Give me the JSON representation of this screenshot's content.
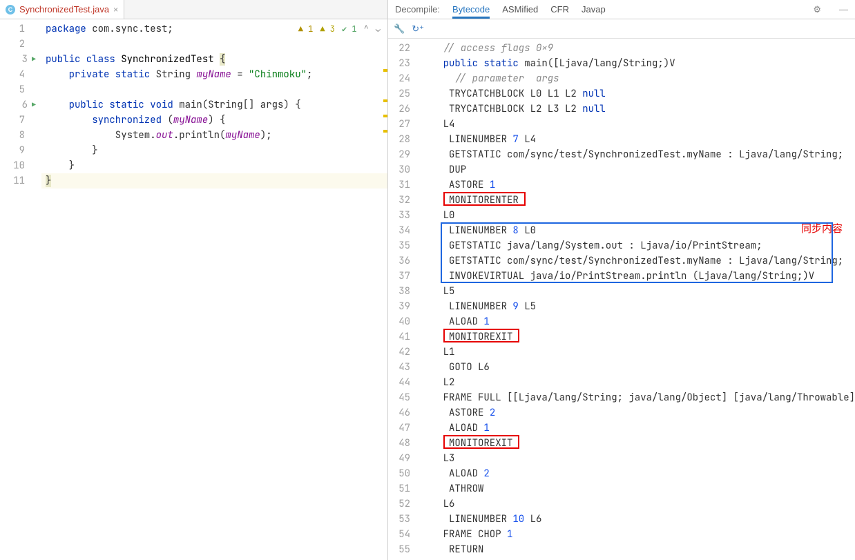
{
  "leftTab": {
    "fileName": "SynchronizedTest.java",
    "fileIconLetter": "C"
  },
  "inspection": {
    "warn1": "1",
    "warn2": "3",
    "ok": "1"
  },
  "sourceLines": [
    {
      "n": "1",
      "run": false,
      "html": "<span class='kw'>package</span> com.sync.test;"
    },
    {
      "n": "2",
      "run": false,
      "html": ""
    },
    {
      "n": "3",
      "run": true,
      "html": "<span class='kw'>public class</span> <span class='cls'>SynchronizedTest</span> <span class='brace'>{</span>"
    },
    {
      "n": "4",
      "run": false,
      "html": "    <span class='kw'>private static</span> String <span class='fld'>myName</span> = <span class='str'>\"Chinmoku\"</span>;"
    },
    {
      "n": "5",
      "run": false,
      "html": ""
    },
    {
      "n": "6",
      "run": true,
      "html": "    <span class='kw'>public static void</span> main(String[] args) {"
    },
    {
      "n": "7",
      "run": false,
      "html": "        <span class='kw'>synchronized</span> (<span class='fld'>myName</span>) {"
    },
    {
      "n": "8",
      "run": false,
      "html": "            System.<span class='fld stat'>out</span>.println(<span class='fld'>myName</span>);"
    },
    {
      "n": "9",
      "run": false,
      "html": "        }"
    },
    {
      "n": "10",
      "run": false,
      "html": "    }"
    },
    {
      "n": "11",
      "run": false,
      "hl": true,
      "html": "<span class='brace'>}</span>"
    }
  ],
  "rightHeader": {
    "label": "Decompile:",
    "tabs": [
      "Bytecode",
      "ASMified",
      "CFR",
      "Javap"
    ],
    "active": 0
  },
  "bytecodeStart": 22,
  "bytecodeLines": [
    {
      "html": "    <span class='cmt'>// access flags 0x9</span>"
    },
    {
      "html": "    <span class='kw'>public static</span> main([Ljava/lang/String;)V"
    },
    {
      "html": "      <span class='cmt'>// parameter  args</span>"
    },
    {
      "html": "     TRYCATCHBLOCK L0 L1 L2 <span class='kw'>null</span>"
    },
    {
      "html": "     TRYCATCHBLOCK L2 L3 L2 <span class='kw'>null</span>"
    },
    {
      "html": "    L4"
    },
    {
      "html": "     LINENUMBER <span class='num'>7</span> L4"
    },
    {
      "html": "     GETSTATIC com/sync/test/SynchronizedTest.myName : Ljava/lang/String;"
    },
    {
      "html": "     DUP"
    },
    {
      "html": "     ASTORE <span class='num'>1</span>"
    },
    {
      "html": "     MONITORENTER"
    },
    {
      "html": "    L0"
    },
    {
      "html": "     LINENUMBER <span class='num'>8</span> L0"
    },
    {
      "html": "     GETSTATIC java/lang/System.out : Ljava/io/PrintStream;"
    },
    {
      "html": "     GETSTATIC com/sync/test/SynchronizedTest.myName : Ljava/lang/String;"
    },
    {
      "html": "     INVOKEVIRTUAL java/io/PrintStream.println (Ljava/lang/String;)V"
    },
    {
      "html": "    L5"
    },
    {
      "html": "     LINENUMBER <span class='num'>9</span> L5"
    },
    {
      "html": "     ALOAD <span class='num'>1</span>"
    },
    {
      "html": "     MONITOREXIT"
    },
    {
      "html": "    L1"
    },
    {
      "html": "     GOTO L6"
    },
    {
      "html": "    L2"
    },
    {
      "html": "    FRAME FULL [[Ljava/lang/String; java/lang/Object] [java/lang/Throwable]"
    },
    {
      "html": "     ASTORE <span class='num'>2</span>"
    },
    {
      "html": "     ALOAD <span class='num'>1</span>"
    },
    {
      "html": "     MONITOREXIT"
    },
    {
      "html": "    L3"
    },
    {
      "html": "     ALOAD <span class='num'>2</span>"
    },
    {
      "html": "     ATHROW"
    },
    {
      "html": "    L6"
    },
    {
      "html": "     LINENUMBER <span class='num'>10</span> L6"
    },
    {
      "html": "    FRAME CHOP <span class='num'>1</span>"
    },
    {
      "html": "     RETURN"
    }
  ],
  "annotationText": "同步内容",
  "redBoxLines": [
    32,
    41,
    48
  ],
  "blueBoxRange": {
    "from": 34,
    "to": 37
  }
}
